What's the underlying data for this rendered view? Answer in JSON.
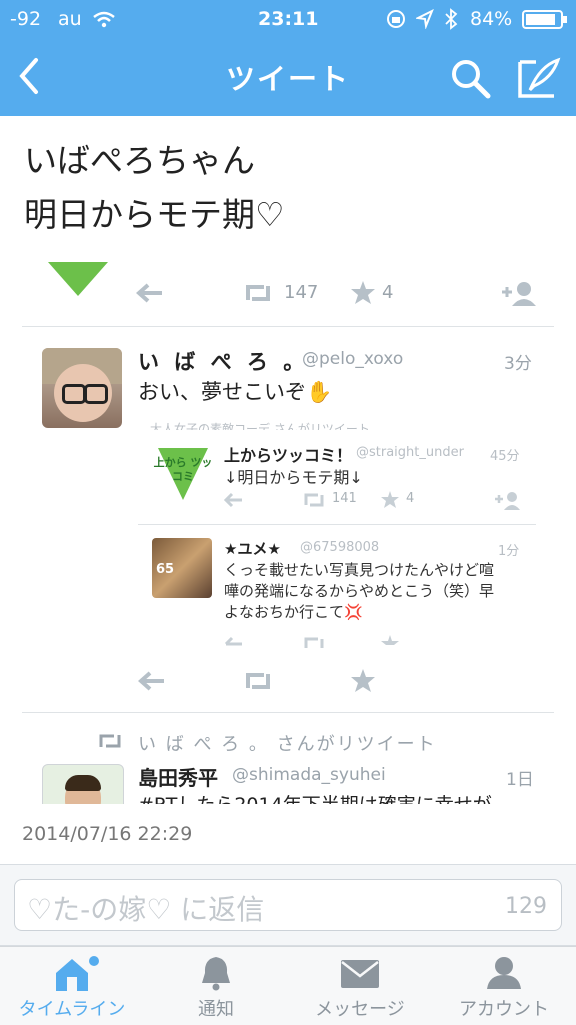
{
  "status": {
    "signal": "-92",
    "carrier": "au",
    "time": "23:11",
    "battery": "84%"
  },
  "nav": {
    "title": "ツイート",
    "back_icon": "chevron-left-icon",
    "search_icon": "search-icon",
    "compose_icon": "compose-icon"
  },
  "tweet": {
    "line1": "いばぺろちゃん",
    "line2": "明日からモテ期♡",
    "timestamp": "2014/07/16 22:29"
  },
  "embed_top": {
    "retweets": "147",
    "favorites": "4"
  },
  "quoted": {
    "name": "い ば ぺ ろ 。",
    "handle": "@pelo_xoxo",
    "age": "3分",
    "text": "おい、夢せこいぞ✋",
    "header_note": "大人女子の素敵コーデ さんがリツイート",
    "inner": [
      {
        "name": "上からツッコミ！",
        "handle": "@straight_under",
        "age": "45分",
        "text": "↓明日からモテ期↓",
        "avatar_text": "上から ツッコミ",
        "retweets": "141",
        "favorites": "4"
      },
      {
        "name": "★ユメ★",
        "handle": "@67598008",
        "age": "1分",
        "text1": "くっそ載せたい写真見つけたんやけど喧",
        "text2": "嘩の発端になるからやめとこう（笑）早",
        "text3": "よなおちか行こて💢"
      }
    ]
  },
  "next_item": {
    "retweeted_by": "い ば ぺ ろ 。 さんがリツイート",
    "name": "島田秀平",
    "handle": "@shimada_syuhei",
    "age": "1日",
    "text": "#RTしたら2014年下半期は確実に幸せが"
  },
  "reply": {
    "placeholder": "♡た-の嫁♡ に返信",
    "count": "129"
  },
  "tabs": [
    {
      "label": "タイムライン",
      "icon": "home-icon"
    },
    {
      "label": "通知",
      "icon": "bell-icon"
    },
    {
      "label": "メッセージ",
      "icon": "envelope-icon"
    },
    {
      "label": "アカウント",
      "icon": "person-icon"
    }
  ],
  "colors": {
    "brand": "#55acee",
    "icon_grey": "#b6c0c8",
    "green": "#6cc04a"
  }
}
